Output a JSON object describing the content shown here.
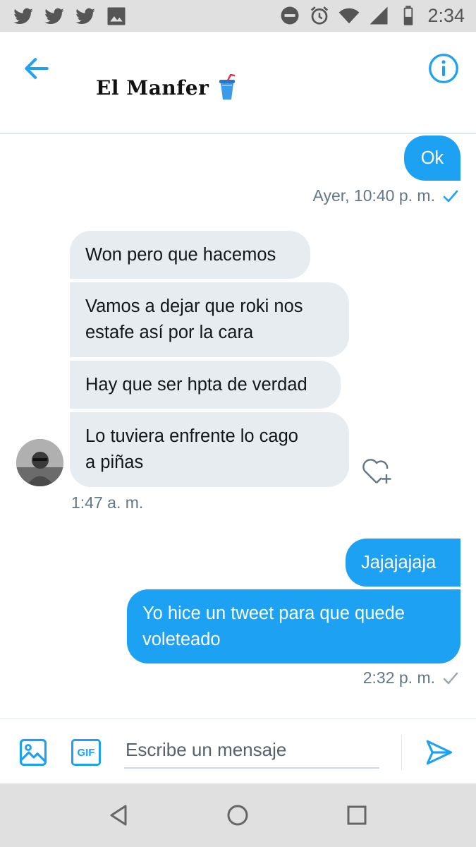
{
  "status_bar": {
    "time": "2:34",
    "left_icons": [
      "twitter-icon",
      "twitter-icon",
      "twitter-icon",
      "gallery-icon"
    ],
    "right_icons": [
      "dnd-icon",
      "alarm-icon",
      "wifi-icon",
      "signal-icon",
      "battery-icon"
    ]
  },
  "header": {
    "title": "El Manfer",
    "title_emoji_icon": "cup-with-straw-icon",
    "back_icon": "back-arrow-icon",
    "info_icon": "info-icon"
  },
  "messages": [
    {
      "direction": "outgoing",
      "text": "Ok"
    },
    {
      "direction": "incoming",
      "text": "Won pero que hacemos"
    },
    {
      "direction": "incoming",
      "text_lines": [
        "Vamos a dejar que roki nos",
        "estafe así por la cara"
      ]
    },
    {
      "direction": "incoming",
      "text": "Hay que ser hpta de verdad"
    },
    {
      "direction": "incoming",
      "text_lines": [
        "Lo tuviera enfrente lo cago",
        "a piñas"
      ]
    },
    {
      "direction": "outgoing",
      "text": "Jajajajaja"
    },
    {
      "direction": "outgoing",
      "text_lines": [
        "Yo hice un tweet para que quede",
        "voleteado"
      ]
    }
  ],
  "timestamps": {
    "first_outgoing": "Ayer, 10:40 p. m.",
    "incoming_group": "1:47 a. m.",
    "last_outgoing": "2:32 p. m."
  },
  "colors": {
    "accent": "#1da1f2",
    "incoming_bubble": "#e6ecf0",
    "meta_text": "#657786",
    "seen_check": "#1da1f2",
    "sent_check": "#9aa5ad"
  },
  "composer": {
    "placeholder": "Escribe un mensaje",
    "gif_label": "GIF"
  },
  "nav_bar": {
    "buttons": [
      "back-triangle-icon",
      "home-circle-icon",
      "recents-square-icon"
    ]
  }
}
